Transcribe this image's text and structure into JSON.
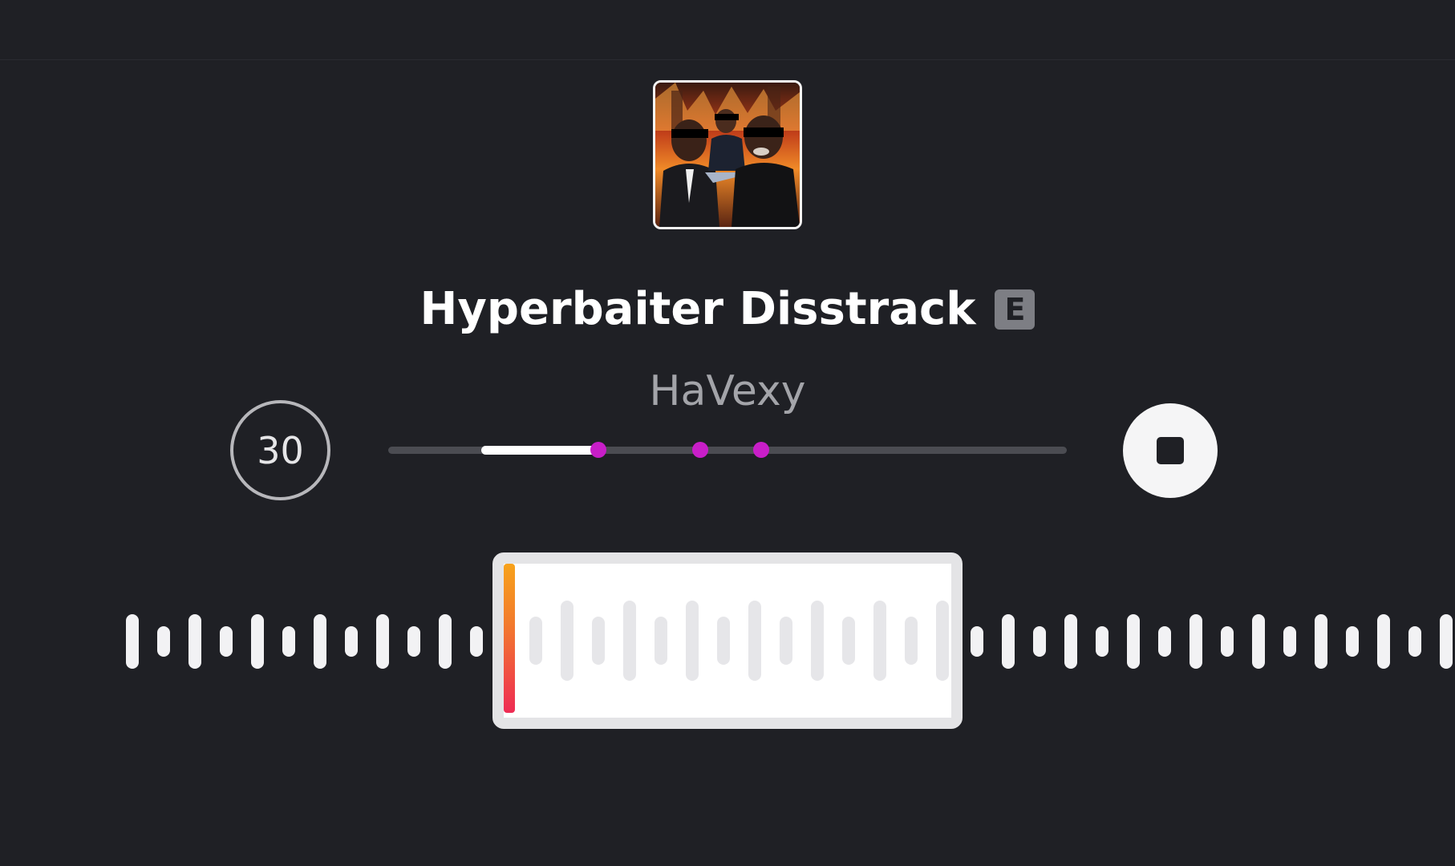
{
  "track": {
    "title": "Hyperbaiter Disstrack",
    "explicit_label": "E",
    "artist": "HaVexy"
  },
  "controls": {
    "timer_label": "30",
    "progress": {
      "selection_start_fraction": 0.137,
      "selection_end_fraction": 0.31,
      "marker_fractions": [
        0.31,
        0.46,
        0.55
      ]
    }
  },
  "colors": {
    "background": "#1f2025",
    "marker": "#c81ec8",
    "handle_gradient": [
      "#f7a21b",
      "#ee2c54"
    ]
  },
  "icons": {
    "timer": "circle-30-icon",
    "stop": "stop-icon",
    "explicit": "explicit-badge-icon"
  }
}
